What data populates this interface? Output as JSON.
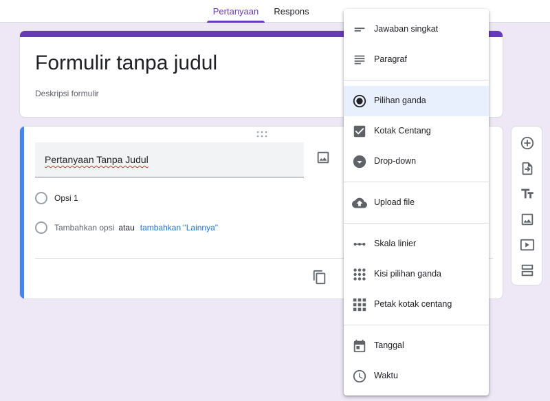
{
  "tabs": [
    {
      "label": "Pertanyaan",
      "active": true
    },
    {
      "label": "Respons",
      "active": false
    }
  ],
  "form": {
    "title": "Formulir tanpa judul",
    "description": "Deskripsi formulir"
  },
  "question": {
    "text": "Pertanyaan Tanpa Judul",
    "option1": "Opsi 1",
    "add_option": "Tambahkan opsi",
    "or": "atau",
    "add_other": "tambahkan \"Lainnya\""
  },
  "question_types": [
    {
      "label": "Jawaban singkat",
      "icon": "short-answer-icon"
    },
    {
      "label": "Paragraf",
      "icon": "paragraph-icon"
    },
    {
      "label": "Pilihan ganda",
      "icon": "radio-button-icon",
      "selected": true
    },
    {
      "label": "Kotak Centang",
      "icon": "checkbox-icon"
    },
    {
      "label": "Drop-down",
      "icon": "dropdown-icon"
    },
    {
      "label": "Upload file",
      "icon": "cloud-upload-icon"
    },
    {
      "label": "Skala linier",
      "icon": "linear-scale-icon"
    },
    {
      "label": "Kisi pilihan ganda",
      "icon": "multiple-choice-grid-icon"
    },
    {
      "label": "Petak kotak centang",
      "icon": "checkbox-grid-icon"
    },
    {
      "label": "Tanggal",
      "icon": "calendar-icon"
    },
    {
      "label": "Waktu",
      "icon": "clock-icon"
    }
  ],
  "toolbar_icons": [
    "add-question-icon",
    "import-questions-icon",
    "add-title-icon",
    "add-image-icon",
    "add-video-icon",
    "add-section-icon"
  ],
  "colors": {
    "accent": "#673ab7",
    "question_accent": "#4285f4",
    "link": "#1a73e8",
    "selected_bg": "#e8f0fe",
    "background": "#ede7f6"
  }
}
